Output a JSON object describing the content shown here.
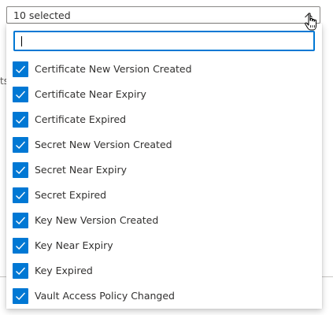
{
  "combobox": {
    "selected_text": "10 selected"
  },
  "search": {
    "value": "",
    "placeholder": ""
  },
  "options": [
    {
      "label": "Certificate New Version Created",
      "checked": true
    },
    {
      "label": "Certificate Near Expiry",
      "checked": true
    },
    {
      "label": "Certificate Expired",
      "checked": true
    },
    {
      "label": "Secret New Version Created",
      "checked": true
    },
    {
      "label": "Secret Near Expiry",
      "checked": true
    },
    {
      "label": "Secret Expired",
      "checked": true
    },
    {
      "label": "Key New Version Created",
      "checked": true
    },
    {
      "label": "Key Near Expiry",
      "checked": true
    },
    {
      "label": "Key Expired",
      "checked": true
    },
    {
      "label": "Vault Access Policy Changed",
      "checked": true
    }
  ],
  "background": {
    "partial_text": "ts"
  },
  "colors": {
    "accent": "#0078d4",
    "text": "#323130",
    "border": "#8a8886"
  },
  "icons": {
    "chevron": "chevron-up-icon",
    "checkmark": "checkmark-icon",
    "cursor": "hand-pointer-icon"
  }
}
